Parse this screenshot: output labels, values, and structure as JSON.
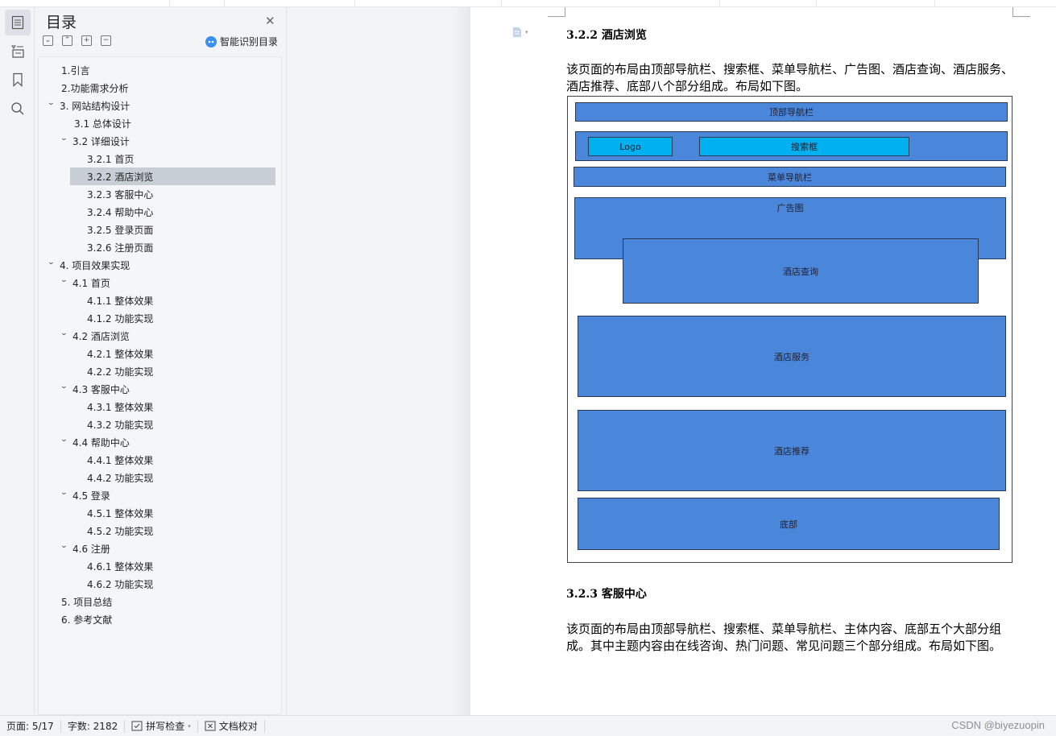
{
  "toc_panel": {
    "title": "目录",
    "smart_label": "智能识别目录",
    "tools": [
      "collapse-all",
      "expand-all",
      "add-level",
      "remove-level"
    ],
    "items": [
      {
        "label": "1.引言",
        "level": 0,
        "chevron": false,
        "selected": false
      },
      {
        "label": "2.功能需求分析",
        "level": 0,
        "chevron": false,
        "selected": false
      },
      {
        "label": "3. 网站结构设计",
        "level": 0,
        "chevron": true,
        "selected": false
      },
      {
        "label": "3.1 总体设计",
        "level": 1,
        "chevron": false,
        "selected": false
      },
      {
        "label": "3.2 详细设计",
        "level": 1,
        "chevron": true,
        "selected": false
      },
      {
        "label": "3.2.1 首页",
        "level": 2,
        "chevron": false,
        "selected": false
      },
      {
        "label": "3.2.2 酒店浏览",
        "level": 2,
        "chevron": false,
        "selected": true
      },
      {
        "label": "3.2.3 客服中心",
        "level": 2,
        "chevron": false,
        "selected": false
      },
      {
        "label": "3.2.4 帮助中心",
        "level": 2,
        "chevron": false,
        "selected": false
      },
      {
        "label": "3.2.5 登录页面",
        "level": 2,
        "chevron": false,
        "selected": false
      },
      {
        "label": "3.2.6 注册页面",
        "level": 2,
        "chevron": false,
        "selected": false
      },
      {
        "label": "4. 项目效果实现",
        "level": 0,
        "chevron": true,
        "selected": false
      },
      {
        "label": "4.1 首页",
        "level": 1,
        "chevron": true,
        "selected": false
      },
      {
        "label": "4.1.1 整体效果",
        "level": 2,
        "chevron": false,
        "selected": false
      },
      {
        "label": "4.1.2 功能实现",
        "level": 2,
        "chevron": false,
        "selected": false
      },
      {
        "label": "4.2 酒店浏览",
        "level": 1,
        "chevron": true,
        "selected": false
      },
      {
        "label": "4.2.1 整体效果",
        "level": 2,
        "chevron": false,
        "selected": false
      },
      {
        "label": "4.2.2 功能实现",
        "level": 2,
        "chevron": false,
        "selected": false
      },
      {
        "label": "4.3 客服中心",
        "level": 1,
        "chevron": true,
        "selected": false
      },
      {
        "label": "4.3.1 整体效果",
        "level": 2,
        "chevron": false,
        "selected": false
      },
      {
        "label": "4.3.2 功能实现",
        "level": 2,
        "chevron": false,
        "selected": false
      },
      {
        "label": "4.4 帮助中心",
        "level": 1,
        "chevron": true,
        "selected": false
      },
      {
        "label": "4.4.1 整体效果",
        "level": 2,
        "chevron": false,
        "selected": false
      },
      {
        "label": "4.4.2 功能实现",
        "level": 2,
        "chevron": false,
        "selected": false
      },
      {
        "label": "4.5 登录",
        "level": 1,
        "chevron": true,
        "selected": false
      },
      {
        "label": "4.5.1 整体效果",
        "level": 2,
        "chevron": false,
        "selected": false
      },
      {
        "label": "4.5.2 功能实现",
        "level": 2,
        "chevron": false,
        "selected": false
      },
      {
        "label": "4.6 注册",
        "level": 1,
        "chevron": true,
        "selected": false
      },
      {
        "label": "4.6.1 整体效果",
        "level": 2,
        "chevron": false,
        "selected": false
      },
      {
        "label": "4.6.2 功能实现",
        "level": 2,
        "chevron": false,
        "selected": false
      },
      {
        "label": "5. 项目总结",
        "level": 0,
        "chevron": false,
        "selected": false
      },
      {
        "label": "6. 参考文献",
        "level": 0,
        "chevron": false,
        "selected": false
      }
    ]
  },
  "document": {
    "section1": {
      "heading": "3.2.2 酒店浏览",
      "paragraph": "该页面的布局由顶部导航栏、搜索框、菜单导航栏、广告图、酒店查询、酒店服务、酒店推荐、底部八个部分组成。布局如下图。"
    },
    "figure": {
      "top_nav": "顶部导航栏",
      "logo": "Logo",
      "search": "搜索框",
      "menu_nav": "菜单导航栏",
      "banner": "广告图",
      "hotel_query": "酒店查询",
      "hotel_service": "酒店服务",
      "hotel_recommend": "酒店推荐",
      "footer": "底部",
      "block_color": "#4a86d9",
      "highlight_color": "#00b0f0"
    },
    "section2": {
      "heading": "3.2.3 客服中心",
      "paragraph": "该页面的布局由顶部导航栏、搜索框、菜单导航栏、主体内容、底部五个大部分组成。其中主题内容由在线咨询、热门问题、常见问题三个部分组成。布局如下图。"
    }
  },
  "status_bar": {
    "page": "页面: 5/17",
    "word_count": "字数: 2182",
    "spell_check": "拼写检查",
    "proofread": "文档校对",
    "watermark": "CSDN @biyezuopin"
  }
}
